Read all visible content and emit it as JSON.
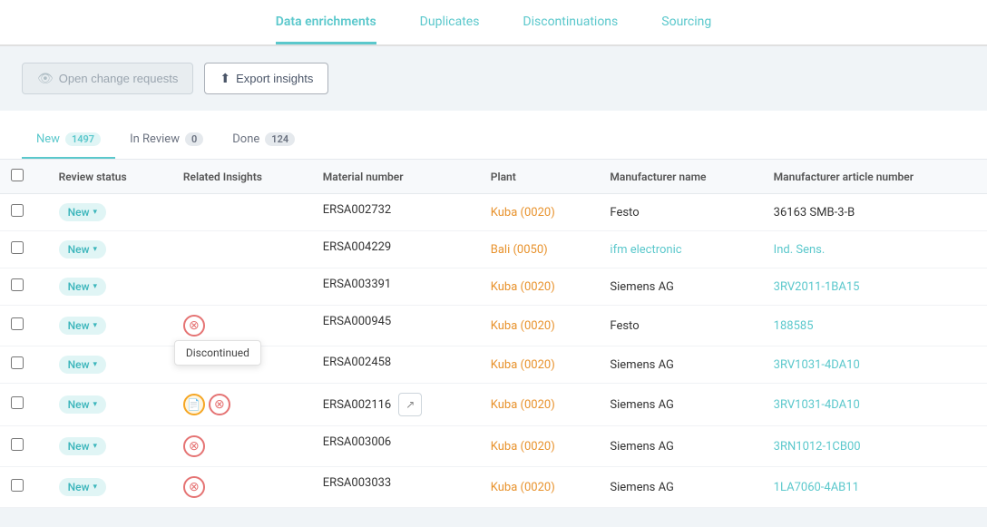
{
  "tabs": [
    {
      "label": "Data enrichments",
      "active": true
    },
    {
      "label": "Duplicates",
      "active": false
    },
    {
      "label": "Discontinuations",
      "active": false
    },
    {
      "label": "Sourcing",
      "active": false
    }
  ],
  "toolbar": {
    "open_change_label": "Open change requests",
    "export_label": "Export insights"
  },
  "sub_tabs": [
    {
      "label": "New",
      "badge": "1497",
      "active": true
    },
    {
      "label": "In Review",
      "badge": "0",
      "active": false
    },
    {
      "label": "Done",
      "badge": "124",
      "active": false
    }
  ],
  "table": {
    "columns": [
      "Review status",
      "Related Insights",
      "Material number",
      "Plant",
      "Manufacturer name",
      "Manufacturer article number"
    ],
    "rows": [
      {
        "status": "New",
        "insights": [],
        "material": "ERSA002732",
        "plant": "Kuba (0020)",
        "manufacturer": "Festo",
        "article": "36163 SMB-3-B",
        "showTooltip": false,
        "showExtLink": false
      },
      {
        "status": "New",
        "insights": [],
        "material": "ERSA004229",
        "plant": "Bali (0050)",
        "manufacturer": "ifm electronic",
        "article": "Ind. Sens.",
        "showTooltip": false,
        "showExtLink": false,
        "plantBlue": true,
        "manufacturerBlue": true,
        "articleBlue": true
      },
      {
        "status": "New",
        "insights": [],
        "material": "ERSA003391",
        "plant": "Kuba (0020)",
        "manufacturer": "Siemens AG",
        "article": "3RV2011-1BA15",
        "showTooltip": false,
        "showExtLink": false,
        "articleBlue": true
      },
      {
        "status": "New",
        "insights": [
          "discontinued"
        ],
        "material": "ERSA000945",
        "plant": "Kuba (0020)",
        "manufacturer": "Festo",
        "article": "188585",
        "showTooltip": true,
        "showExtLink": false,
        "articleBlue": true
      },
      {
        "status": "New",
        "insights": [],
        "material": "ERSA002458",
        "plant": "Kuba (0020)",
        "manufacturer": "Siemens AG",
        "article": "3RV1031-4DA10",
        "showTooltip": false,
        "showExtLink": false,
        "articleBlue": true
      },
      {
        "status": "New",
        "insights": [
          "document",
          "discontinued"
        ],
        "material": "ERSA002116",
        "plant": "Kuba (0020)",
        "manufacturer": "Siemens AG",
        "article": "3RV1031-4DA10",
        "showTooltip": false,
        "showExtLink": true,
        "articleBlue": true
      },
      {
        "status": "New",
        "insights": [
          "discontinued"
        ],
        "material": "ERSA003006",
        "plant": "Kuba (0020)",
        "manufacturer": "Siemens AG",
        "article": "3RN1012-1CB00",
        "showTooltip": false,
        "showExtLink": false,
        "articleBlue": true
      },
      {
        "status": "New",
        "insights": [
          "discontinued"
        ],
        "material": "ERSA003033",
        "plant": "Kuba (0020)",
        "manufacturer": "Siemens AG",
        "article": "1LA7060-4AB11",
        "showTooltip": false,
        "showExtLink": false,
        "articleBlue": true
      }
    ]
  },
  "tooltip": {
    "discontinued_label": "Discontinued"
  }
}
